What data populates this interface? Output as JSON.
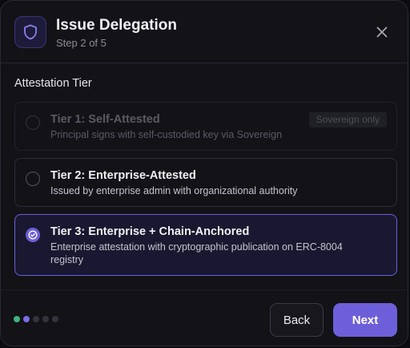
{
  "dialog": {
    "title": "Issue Delegation",
    "step_text": "Step 2 of 5",
    "icon": "shield-icon",
    "close_icon": "close-icon"
  },
  "section": {
    "label": "Attestation Tier"
  },
  "options": [
    {
      "title": "Tier 1: Self-Attested",
      "description": "Principal signs with self-custodied key via Sovereign",
      "badge": "Sovereign only",
      "state": "disabled"
    },
    {
      "title": "Tier 2: Enterprise-Attested",
      "description": "Issued by enterprise admin with organizational authority",
      "state": "unselected"
    },
    {
      "title": "Tier 3: Enterprise + Chain-Anchored",
      "description": "Enterprise attestation with cryptographic publication on ERC-8004 registry",
      "state": "selected"
    }
  ],
  "footer": {
    "progress": {
      "total_steps": 5,
      "current_step": 2,
      "completed_color": "#3fb37f",
      "current_color": "#7b6ee8",
      "pending_color": "#33333c"
    },
    "back_label": "Back",
    "next_label": "Next"
  },
  "colors": {
    "accent": "#6d5fd9",
    "background": "#121217"
  }
}
